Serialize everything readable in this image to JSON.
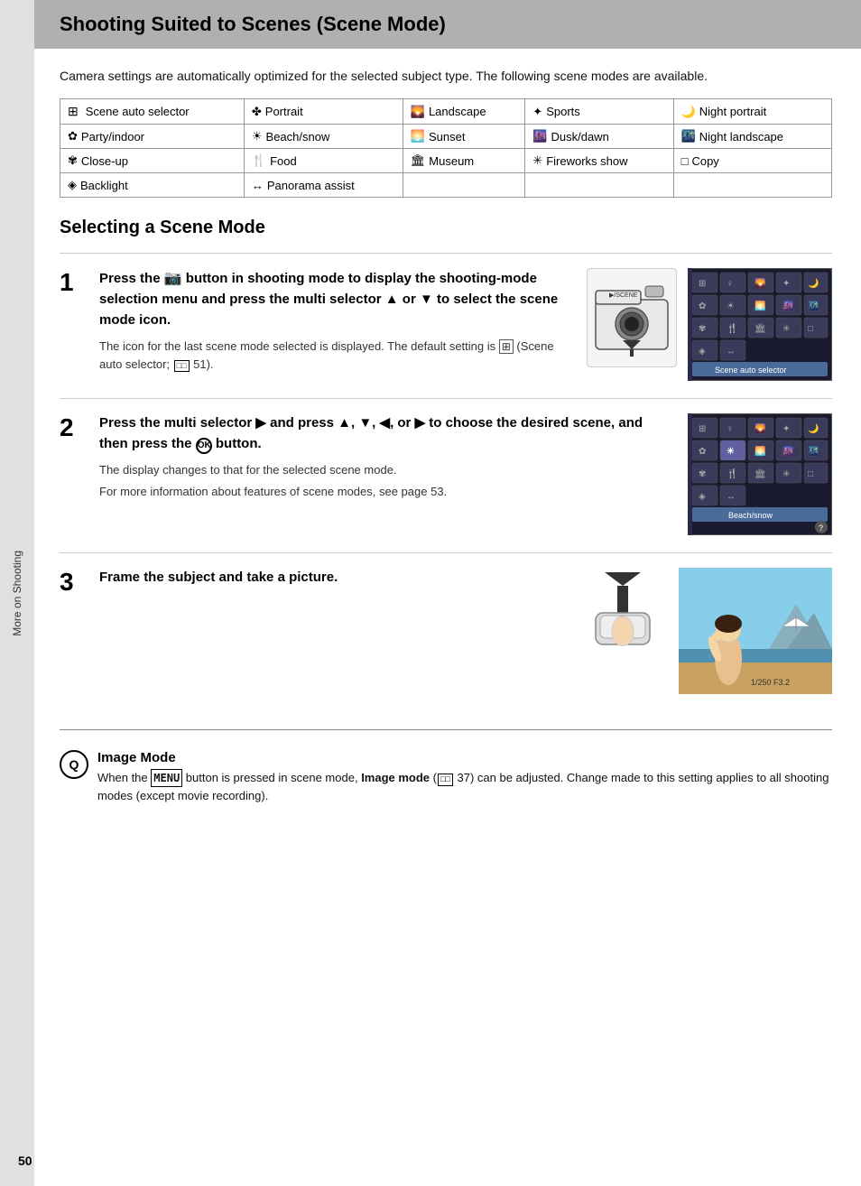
{
  "page": {
    "title": "Shooting Suited to Scenes (Scene Mode)",
    "sidebar_label": "More on Shooting",
    "page_number": "50",
    "intro": "Camera settings are automatically optimized for the selected subject type. The following scene modes are available."
  },
  "scene_table": {
    "rows": [
      [
        {
          "icon": "⊞",
          "label": "Scene auto selector"
        },
        {
          "icon": "♀",
          "label": "Portrait"
        },
        {
          "icon": "⛰",
          "label": "Landscape"
        },
        {
          "icon": "🏃",
          "label": "Sports"
        },
        {
          "icon": "🌙",
          "label": "Night portrait"
        }
      ],
      [
        {
          "icon": "🎉",
          "label": "Party/indoor"
        },
        {
          "icon": "🏖",
          "label": "Beach/snow"
        },
        {
          "icon": "🌅",
          "label": "Sunset"
        },
        {
          "icon": "🌄",
          "label": "Dusk/dawn"
        },
        {
          "icon": "🌃",
          "label": "Night landscape"
        }
      ],
      [
        {
          "icon": "🌸",
          "label": "Close-up"
        },
        {
          "icon": "🍴",
          "label": "Food"
        },
        {
          "icon": "🏛",
          "label": "Museum"
        },
        {
          "icon": "✨",
          "label": "Fireworks show"
        },
        {
          "icon": "□",
          "label": "Copy"
        }
      ],
      [
        {
          "icon": "💡",
          "label": "Backlight"
        },
        {
          "icon": "↔",
          "label": "Panorama assist"
        },
        null,
        null,
        null
      ]
    ]
  },
  "selecting_section": {
    "title": "Selecting a Scene Mode"
  },
  "steps": [
    {
      "number": "1",
      "main": "Press the  button in shooting mode to display the shooting-mode selection menu and press the multi selector ▲ or ▼ to select the scene mode icon.",
      "sub": "The icon for the last scene mode selected is displayed. The default setting is  (Scene auto selector;  51).",
      "lcd_label": "Scene auto selector"
    },
    {
      "number": "2",
      "main": "Press the multi selector ▶ and press ▲, ▼, ◀, or ▶ to choose the desired scene, and then press the  button.",
      "sub1": "The display changes to that for the selected scene mode.",
      "sub2": "For more information about features of scene modes, see page 53.",
      "lcd_label": "Beach/snow"
    },
    {
      "number": "3",
      "main": "Frame the subject and take a picture.",
      "sub": ""
    }
  ],
  "note": {
    "icon": "Q",
    "title": "Image Mode",
    "text": "When the MENU button is pressed in scene mode, Image mode (  37) can be adjusted. Change made to this setting applies to all shooting modes (except movie recording)."
  }
}
